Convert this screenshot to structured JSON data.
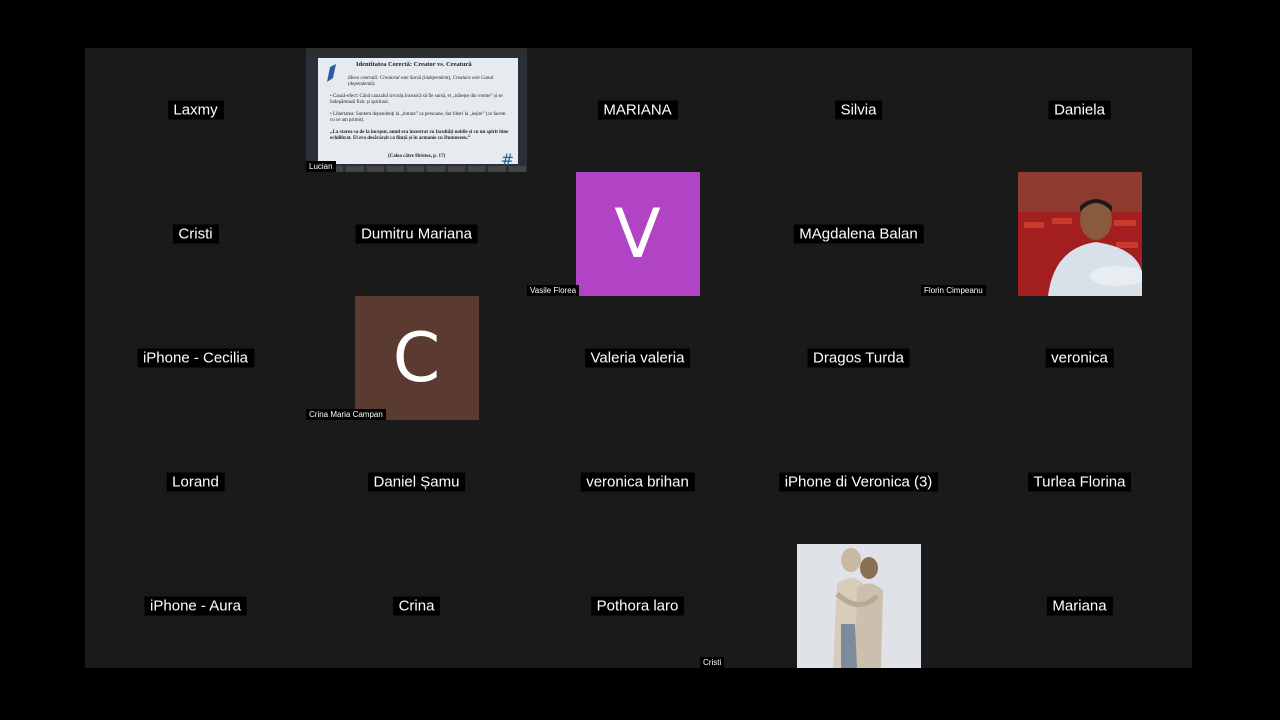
{
  "participants": {
    "laxmy": "Laxmy",
    "lucian": "Lucian",
    "mariana_caps": "MARIANA",
    "silvia": "Silvia",
    "daniela": "Daniela",
    "cristi_1": "Cristi",
    "dumitru_mariana": "Dumitru Mariana",
    "vasile_florea": "Vasile Florea",
    "vasile_initial": "V",
    "magdalena_balan": "MAgdalena Balan",
    "florin_cimpeanu": "Florin Cimpeanu",
    "iphone_cecilia": "iPhone - Cecilia",
    "crina_maria_campan": "Crina Maria Campan",
    "crina_initial": "C",
    "valeria_valeria": "Valeria valeria",
    "dragos_turda": "Dragos Turda",
    "veronica": "veronica",
    "lorand": "Lorand",
    "daniel_samu": "Daniel Șamu",
    "veronica_brihan": "veronica brihan",
    "iphone_di_veronica": "iPhone di Veronica (3)",
    "turlea_florina": "Turlea Florina",
    "iphone_aura": "iPhone - Aura",
    "crina": "Crina",
    "pothora_iaro": "Pothora laro",
    "cristi_2": "Cristi",
    "mariana": "Mariana"
  },
  "shared_slide": {
    "title": "Identitatea Corectă: Creator vs. Creatură",
    "line1": "Ideea centrală: Creatorul este Sursă (independent), Creatura este Canal (dependentă).",
    "line2": "• Cauză-efect: Când cauzalul izvorăș încearcă să fie sursă, el „trăiește din vreme” și se îndepărtează fizic și spiritual.",
    "line3": "• Libertatea: Suntem dependenți la „intrare” ca persoane, dar liberi la „ieșire” (ce facem cu ce am primit).",
    "line4": "„La starea sa de la început, omul era înzestrat cu facultăți nobile și cu un spirit bine echilibrat. El era desăvârșit ca ființă și în armonie cu Dumnezeu.”",
    "line5": "(Calea către Hristos, p. 17)"
  },
  "colors": {
    "vasile_avatar": "#b044c4",
    "crina_avatar": "#5b3a31",
    "grid_background": "#1a1a1a"
  }
}
